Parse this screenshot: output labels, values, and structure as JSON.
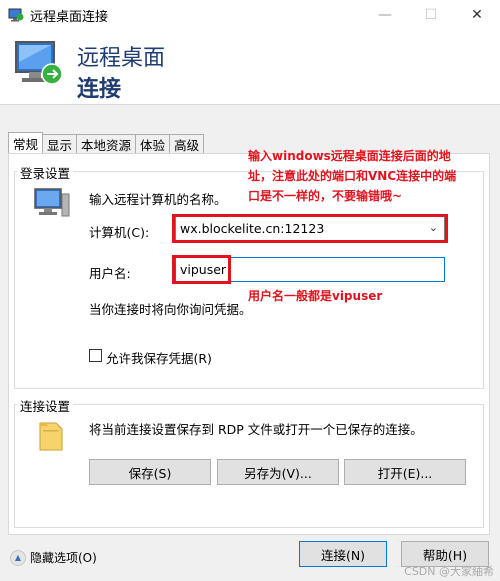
{
  "window": {
    "title": "远程桌面连接",
    "minimize": "—",
    "maximize": "☐",
    "close": "✕"
  },
  "banner": {
    "line1": "远程桌面",
    "line2": "连接"
  },
  "tabs": [
    {
      "label": "常规",
      "active": true
    },
    {
      "label": "显示"
    },
    {
      "label": "本地资源"
    },
    {
      "label": "体验"
    },
    {
      "label": "高级"
    }
  ],
  "login": {
    "group_label": "登录设置",
    "prompt": "输入远程计算机的名称。",
    "computer_label": "计算机(C):",
    "computer_value": "wx.blockelite.cn:12123",
    "username_label": "用户名:",
    "username_value": "vipuser",
    "credential_note": "当你连接时将向你询问凭据。",
    "save_credentials": "允许我保存凭据(R)",
    "save_credentials_checked": false
  },
  "connection": {
    "group_label": "连接设置",
    "description": "将当前连接设置保存到 RDP 文件或打开一个已保存的连接。",
    "save_button": "保存(S)",
    "save_as_button": "另存为(V)...",
    "open_button": "打开(E)..."
  },
  "footer": {
    "hide_options": "隐藏选项(O)",
    "connect_button": "连接(N)",
    "help_button": "帮助(H)"
  },
  "annotations": {
    "note_top_line1": "输入windows远程桌面连接后面的地",
    "note_top_line2": "址，注意此处的端口和VNC连接中的端",
    "note_top_line3": "口是不一样的，不要输错哦~",
    "note_user": "用户名一般都是vipuser",
    "highlight_color": "#e0141e"
  },
  "watermark": "CSDN @大家紬希"
}
